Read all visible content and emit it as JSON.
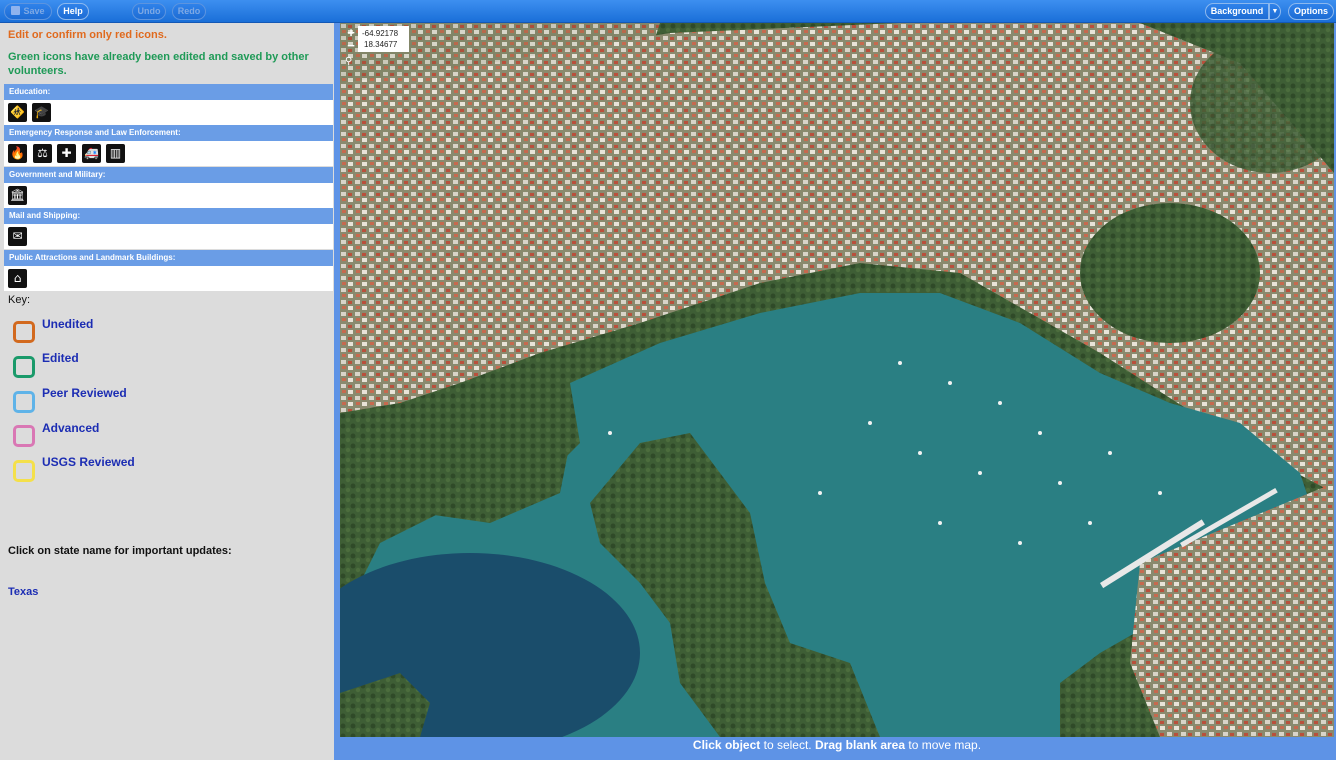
{
  "toolbar": {
    "save_label": "Save",
    "help_label": "Help",
    "undo_label": "Undo",
    "redo_label": "Redo",
    "background_label": "Background",
    "options_label": "Options"
  },
  "sidebar": {
    "instruction_orange": "Edit or confirm only red icons.",
    "instruction_green": "Green icons have already been edited and saved by other volunteers.",
    "categories": [
      {
        "label": "Education:",
        "icons": [
          "school-icon",
          "college-icon"
        ]
      },
      {
        "label": "Emergency Response and Law Enforcement:",
        "icons": [
          "fire-station-icon",
          "law-enforcement-icon",
          "hospital-icon",
          "ambulance-icon",
          "prison-icon"
        ]
      },
      {
        "label": "Government and Military:",
        "icons": [
          "government-building-icon"
        ]
      },
      {
        "label": "Mail and Shipping:",
        "icons": [
          "mail-icon"
        ]
      },
      {
        "label": "Public Attractions and Landmark Buildings:",
        "icons": [
          "landmark-icon"
        ]
      }
    ],
    "key_title": "Key:",
    "key": [
      {
        "label": "Unedited",
        "color": "#d2691e"
      },
      {
        "label": "Edited",
        "color": "#1a9a6a"
      },
      {
        "label": "Peer Reviewed",
        "color": "#5fb3e8"
      },
      {
        "label": "Advanced",
        "color": "#d977b4"
      },
      {
        "label": "USGS Reviewed",
        "color": "#f4e04a"
      }
    ],
    "updates_text": "Click on state name for important updates:",
    "state_link": "Texas"
  },
  "map": {
    "zoom_in": "+",
    "zoom_out": "−",
    "coord_lon": "-64.92178",
    "coord_lat": "18.34677"
  },
  "status": {
    "part1_bold": "Click object",
    "part2": " to select. ",
    "part3_bold": "Drag blank area",
    "part4": " to move map."
  }
}
